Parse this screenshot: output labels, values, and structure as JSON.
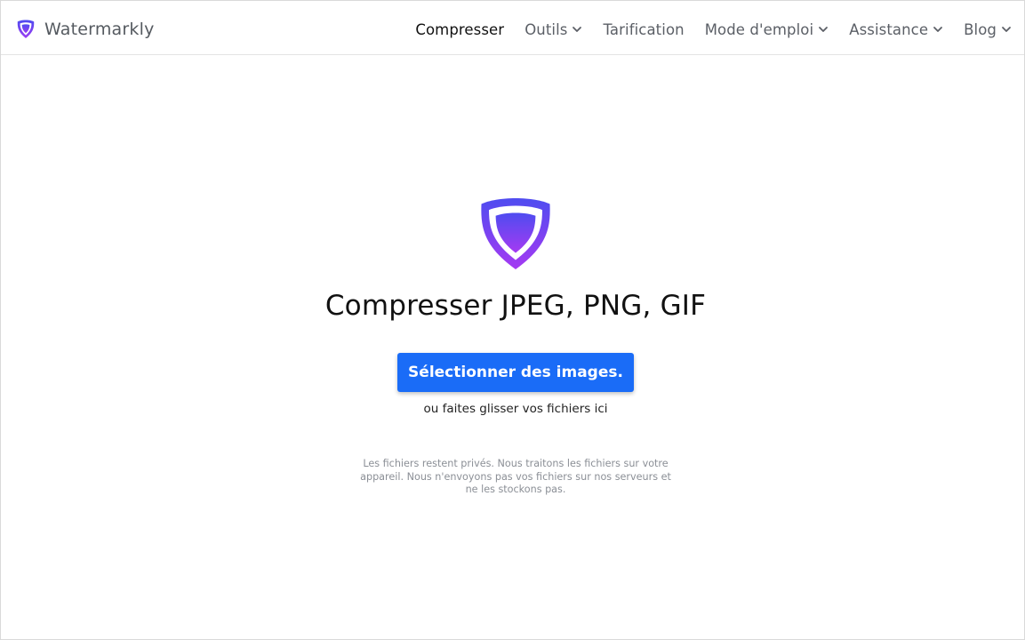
{
  "brand": {
    "name": "Watermarkly",
    "logo_icon": "shield-icon"
  },
  "nav": {
    "items": [
      {
        "label": "Compresser",
        "active": true,
        "dropdown": false
      },
      {
        "label": "Outils",
        "active": false,
        "dropdown": true
      },
      {
        "label": "Tarification",
        "active": false,
        "dropdown": false
      },
      {
        "label": "Mode d'emploi",
        "active": false,
        "dropdown": true
      },
      {
        "label": "Assistance",
        "active": false,
        "dropdown": true
      },
      {
        "label": "Blog",
        "active": false,
        "dropdown": true
      }
    ]
  },
  "main": {
    "logo_icon": "shield-icon",
    "title": "Compresser JPEG, PNG, GIF",
    "select_button_label": "Sélectionner des images.",
    "drop_hint": "ou faites glisser vos fichiers ici",
    "privacy_note": "Les fichiers restent privés. Nous traitons les fichiers sur votre appareil. Nous n'envoyons pas vos fichiers sur nos serveurs et ne les stockons pas."
  },
  "colors": {
    "accent": "#1a6cf7",
    "shield_gradient_top": "#4f4cf0",
    "shield_gradient_bottom": "#9b3cf2",
    "text_primary": "#111111",
    "text_muted": "#8b8f96"
  }
}
